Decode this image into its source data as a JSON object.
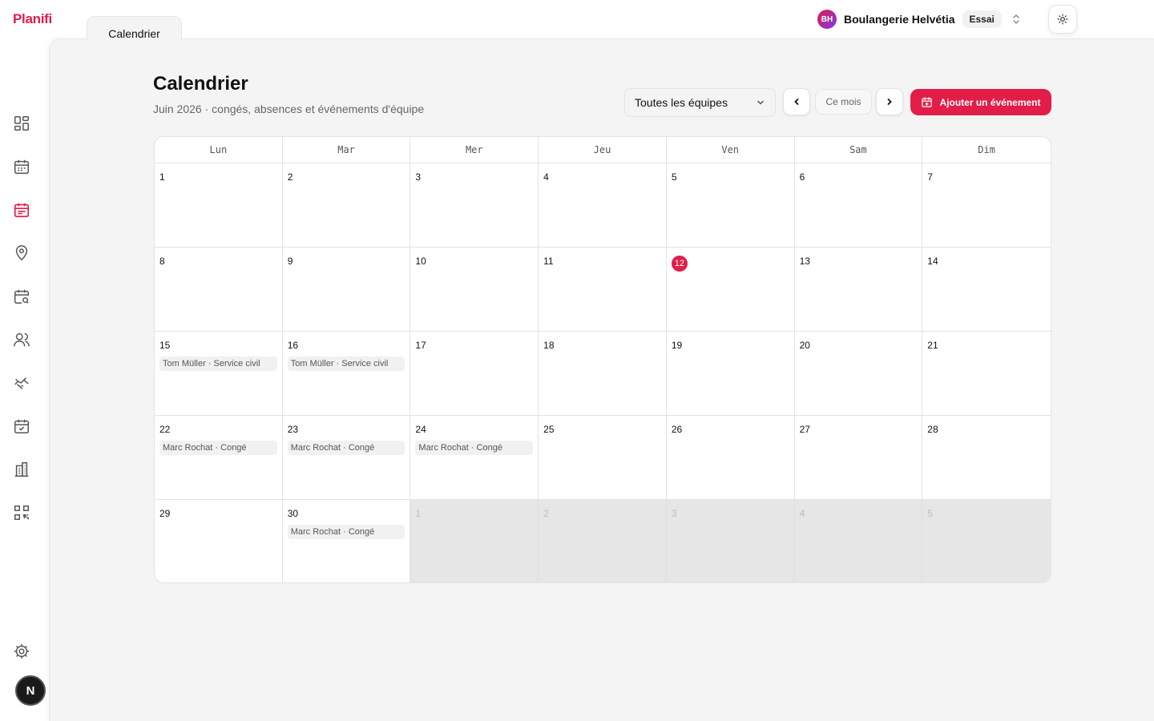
{
  "app": {
    "logo": "Planifi",
    "tab": "Calendrier"
  },
  "org": {
    "initials": "BH",
    "name": "Boulangerie Helvétia",
    "badge": "Essai"
  },
  "user": {
    "initial": "N"
  },
  "page": {
    "title": "Calendrier",
    "subtitle": "Juin 2026 · congés, absences et événements d'équipe"
  },
  "toolbar": {
    "team_filter": "Toutes les équipes",
    "current_month": "Ce mois",
    "add_event": "Ajouter un événement"
  },
  "colors": {
    "accent": "#e11d48"
  },
  "calendar": {
    "weekdays": [
      "Lun",
      "Mar",
      "Mer",
      "Jeu",
      "Ven",
      "Sam",
      "Dim"
    ],
    "days": [
      {
        "n": "1"
      },
      {
        "n": "2"
      },
      {
        "n": "3"
      },
      {
        "n": "4"
      },
      {
        "n": "5"
      },
      {
        "n": "6"
      },
      {
        "n": "7"
      },
      {
        "n": "8"
      },
      {
        "n": "9"
      },
      {
        "n": "10"
      },
      {
        "n": "11"
      },
      {
        "n": "12",
        "today": true
      },
      {
        "n": "13"
      },
      {
        "n": "14"
      },
      {
        "n": "15",
        "events": [
          "Tom Müller · Service civil"
        ]
      },
      {
        "n": "16",
        "events": [
          "Tom Müller · Service civil"
        ]
      },
      {
        "n": "17"
      },
      {
        "n": "18"
      },
      {
        "n": "19"
      },
      {
        "n": "20"
      },
      {
        "n": "21"
      },
      {
        "n": "22",
        "events": [
          "Marc Rochat · Congé"
        ]
      },
      {
        "n": "23",
        "events": [
          "Marc Rochat · Congé"
        ]
      },
      {
        "n": "24",
        "events": [
          "Marc Rochat · Congé"
        ]
      },
      {
        "n": "25"
      },
      {
        "n": "26"
      },
      {
        "n": "27"
      },
      {
        "n": "28"
      },
      {
        "n": "29"
      },
      {
        "n": "30",
        "events": [
          "Marc Rochat · Congé"
        ]
      },
      {
        "n": "1",
        "outside": true
      },
      {
        "n": "2",
        "outside": true
      },
      {
        "n": "3",
        "outside": true
      },
      {
        "n": "4",
        "outside": true
      },
      {
        "n": "5",
        "outside": true
      }
    ]
  },
  "sidebar": {
    "items": [
      {
        "icon": "dashboard-icon"
      },
      {
        "icon": "calendar-icon"
      },
      {
        "icon": "calendar-list-icon",
        "active": true
      },
      {
        "icon": "location-pin-icon"
      },
      {
        "icon": "calendar-search-icon"
      },
      {
        "icon": "users-icon"
      },
      {
        "icon": "handshake-icon"
      },
      {
        "icon": "calendar-check-icon"
      },
      {
        "icon": "building-icon"
      },
      {
        "icon": "qr-code-icon"
      }
    ],
    "settings_icon": "gear-icon"
  }
}
